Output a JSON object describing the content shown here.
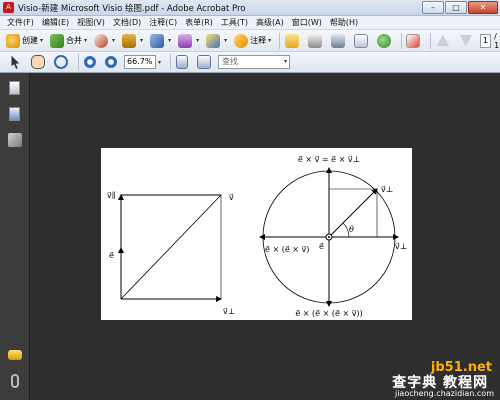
{
  "window": {
    "title": "Visio-新建 Microsoft Visio 绘图.pdf - Adobe Acrobat Pro",
    "app_icon_glyph": "A",
    "minimize": "–",
    "maximize": "□",
    "close": "✕"
  },
  "menubar": {
    "items": [
      "文件(F)",
      "编辑(E)",
      "视图(V)",
      "文档(D)",
      "注释(C)",
      "表单(R)",
      "工具(T)",
      "高级(A)",
      "窗口(W)",
      "帮助(H)"
    ]
  },
  "toolbar1": {
    "create_label": "创建",
    "combine_label": "合并",
    "comment_label": "注释",
    "page_number": "1",
    "page_total": "/ 1",
    "caret": "▾"
  },
  "toolbar2": {
    "zoom_value": "66.7%",
    "find_placeholder": "查找",
    "caret": "▾"
  },
  "figure": {
    "left": {
      "label_v": "v⃗",
      "label_v_parallel": "v⃗∥",
      "label_e": "e⃗",
      "label_v_perp": "v⃗⊥"
    },
    "right": {
      "top_label": "e⃗ × v⃗ = e⃗ × v⃗⊥",
      "label_v_perp_arrow": "v⃗⊥",
      "label_theta": "θ",
      "label_left": "e⃗ × (e⃗ × v⃗)",
      "label_center": "e⃗",
      "label_right": "v⃗⊥",
      "bottom_label": "e⃗ × (e⃗ × (e⃗ × v⃗))"
    }
  },
  "watermark": {
    "site": "jb51.net",
    "main": "查字典 教程网",
    "url": "jiaocheng.chazidian.com"
  },
  "colors": {
    "acrobat_red": "#c4161c",
    "doc_background": "#2e2e2e",
    "watermark_orange": "#ffb000"
  }
}
